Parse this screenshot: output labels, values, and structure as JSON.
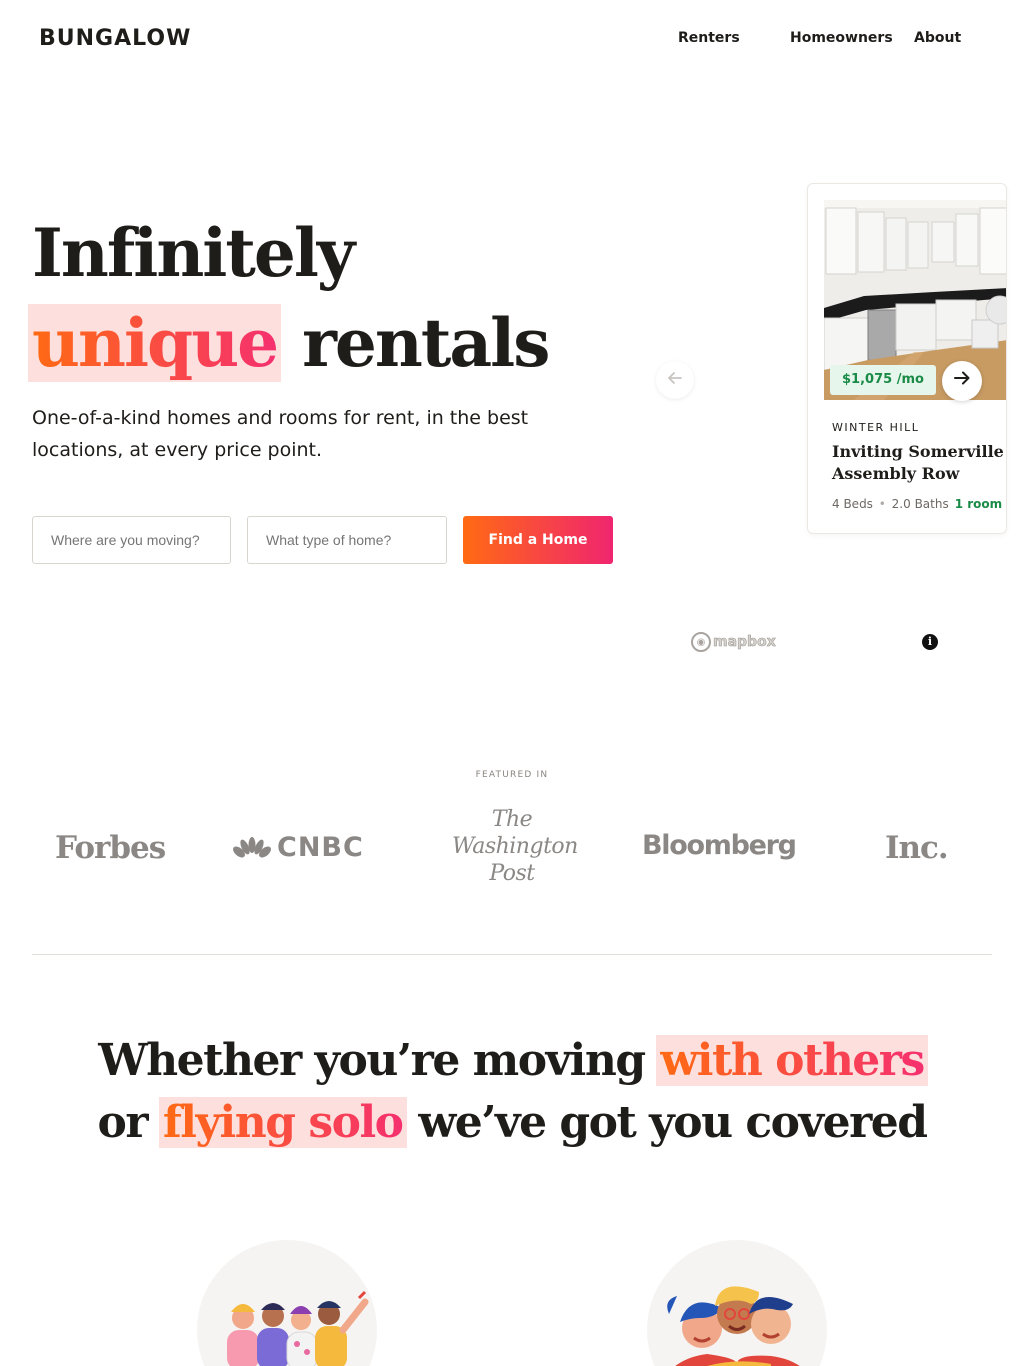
{
  "header": {
    "logo": "BUNGALOW",
    "nav": {
      "renters": "Renters",
      "homeowners": "Homeowners",
      "about": "About"
    }
  },
  "hero": {
    "title_line1": "Infinitely",
    "title_highlight": "unique",
    "title_line2_rest": " rentals",
    "subtitle": "One-of-a-kind homes and rooms for rent, in the best locations, at every price point.",
    "search": {
      "where_placeholder": "Where are you moving?",
      "type_placeholder": "What type of home?",
      "cta_label": "Find a Home"
    }
  },
  "listing_card": {
    "price": "$1,075 /mo",
    "neighborhood": "WINTER HILL",
    "title_line1": "Inviting Somerville",
    "title_line2": "Assembly Row",
    "beds": "4 Beds",
    "baths": "2.0 Baths",
    "rooms": "1 room"
  },
  "carousel": {
    "prev_icon": "arrow-left-icon",
    "next_icon": "arrow-right-icon"
  },
  "map_attribution": {
    "label": "mapbox",
    "info_icon": "info-icon"
  },
  "featured": {
    "label": "FEATURED IN",
    "outlets": {
      "forbes": "Forbes",
      "cnbc": "CNBC",
      "wapo_line1": "The",
      "wapo_line2": "Washington",
      "wapo_line3": "Post",
      "bloomberg": "Bloomberg",
      "inc": "Inc."
    }
  },
  "section2": {
    "line1_start": "Whether you’re moving ",
    "line1_highlight": "with others",
    "line2_start": "or ",
    "line2_highlight": "flying solo",
    "line2_end": " we’ve got you covered"
  },
  "colors": {
    "accent_start": "#ff6a13",
    "accent_end": "#f0256f",
    "highlight_bg": "#fde0dd",
    "price_green": "#1a8b46",
    "text_dark": "#1f1d1a",
    "press_gray": "#8a8784"
  }
}
